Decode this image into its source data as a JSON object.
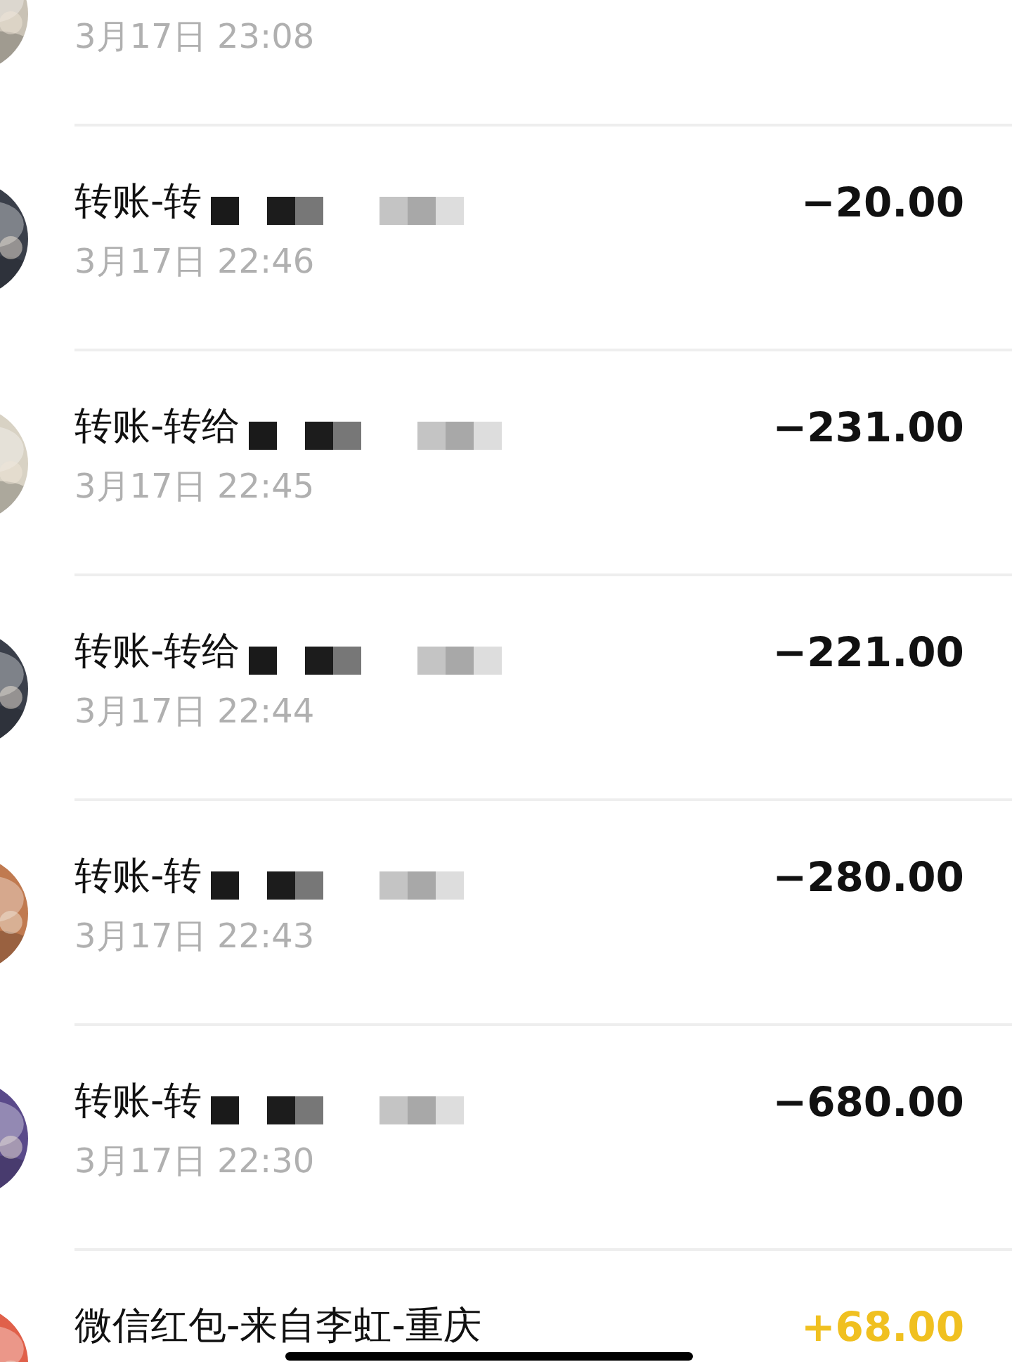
{
  "transactions": [
    {
      "time": "3月17日 23:08"
    },
    {
      "title": "转账-转",
      "time": "3月17日 22:46",
      "amount": "−20.00",
      "kind": "expense",
      "redacted": true
    },
    {
      "title": "转账-转给",
      "time": "3月17日 22:45",
      "amount": "−231.00",
      "kind": "expense",
      "redacted": true
    },
    {
      "title": "转账-转给",
      "time": "3月17日 22:44",
      "amount": "−221.00",
      "kind": "expense",
      "redacted": true
    },
    {
      "title": "转账-转",
      "time": "3月17日 22:43",
      "amount": "−280.00",
      "kind": "expense",
      "redacted": true
    },
    {
      "title": "转账-转",
      "time": "3月17日 22:30",
      "amount": "−680.00",
      "kind": "expense",
      "redacted": true
    },
    {
      "title": "微信红包-来自李虹-重庆",
      "amount": "+68.00",
      "kind": "income",
      "scribbled": true
    }
  ]
}
